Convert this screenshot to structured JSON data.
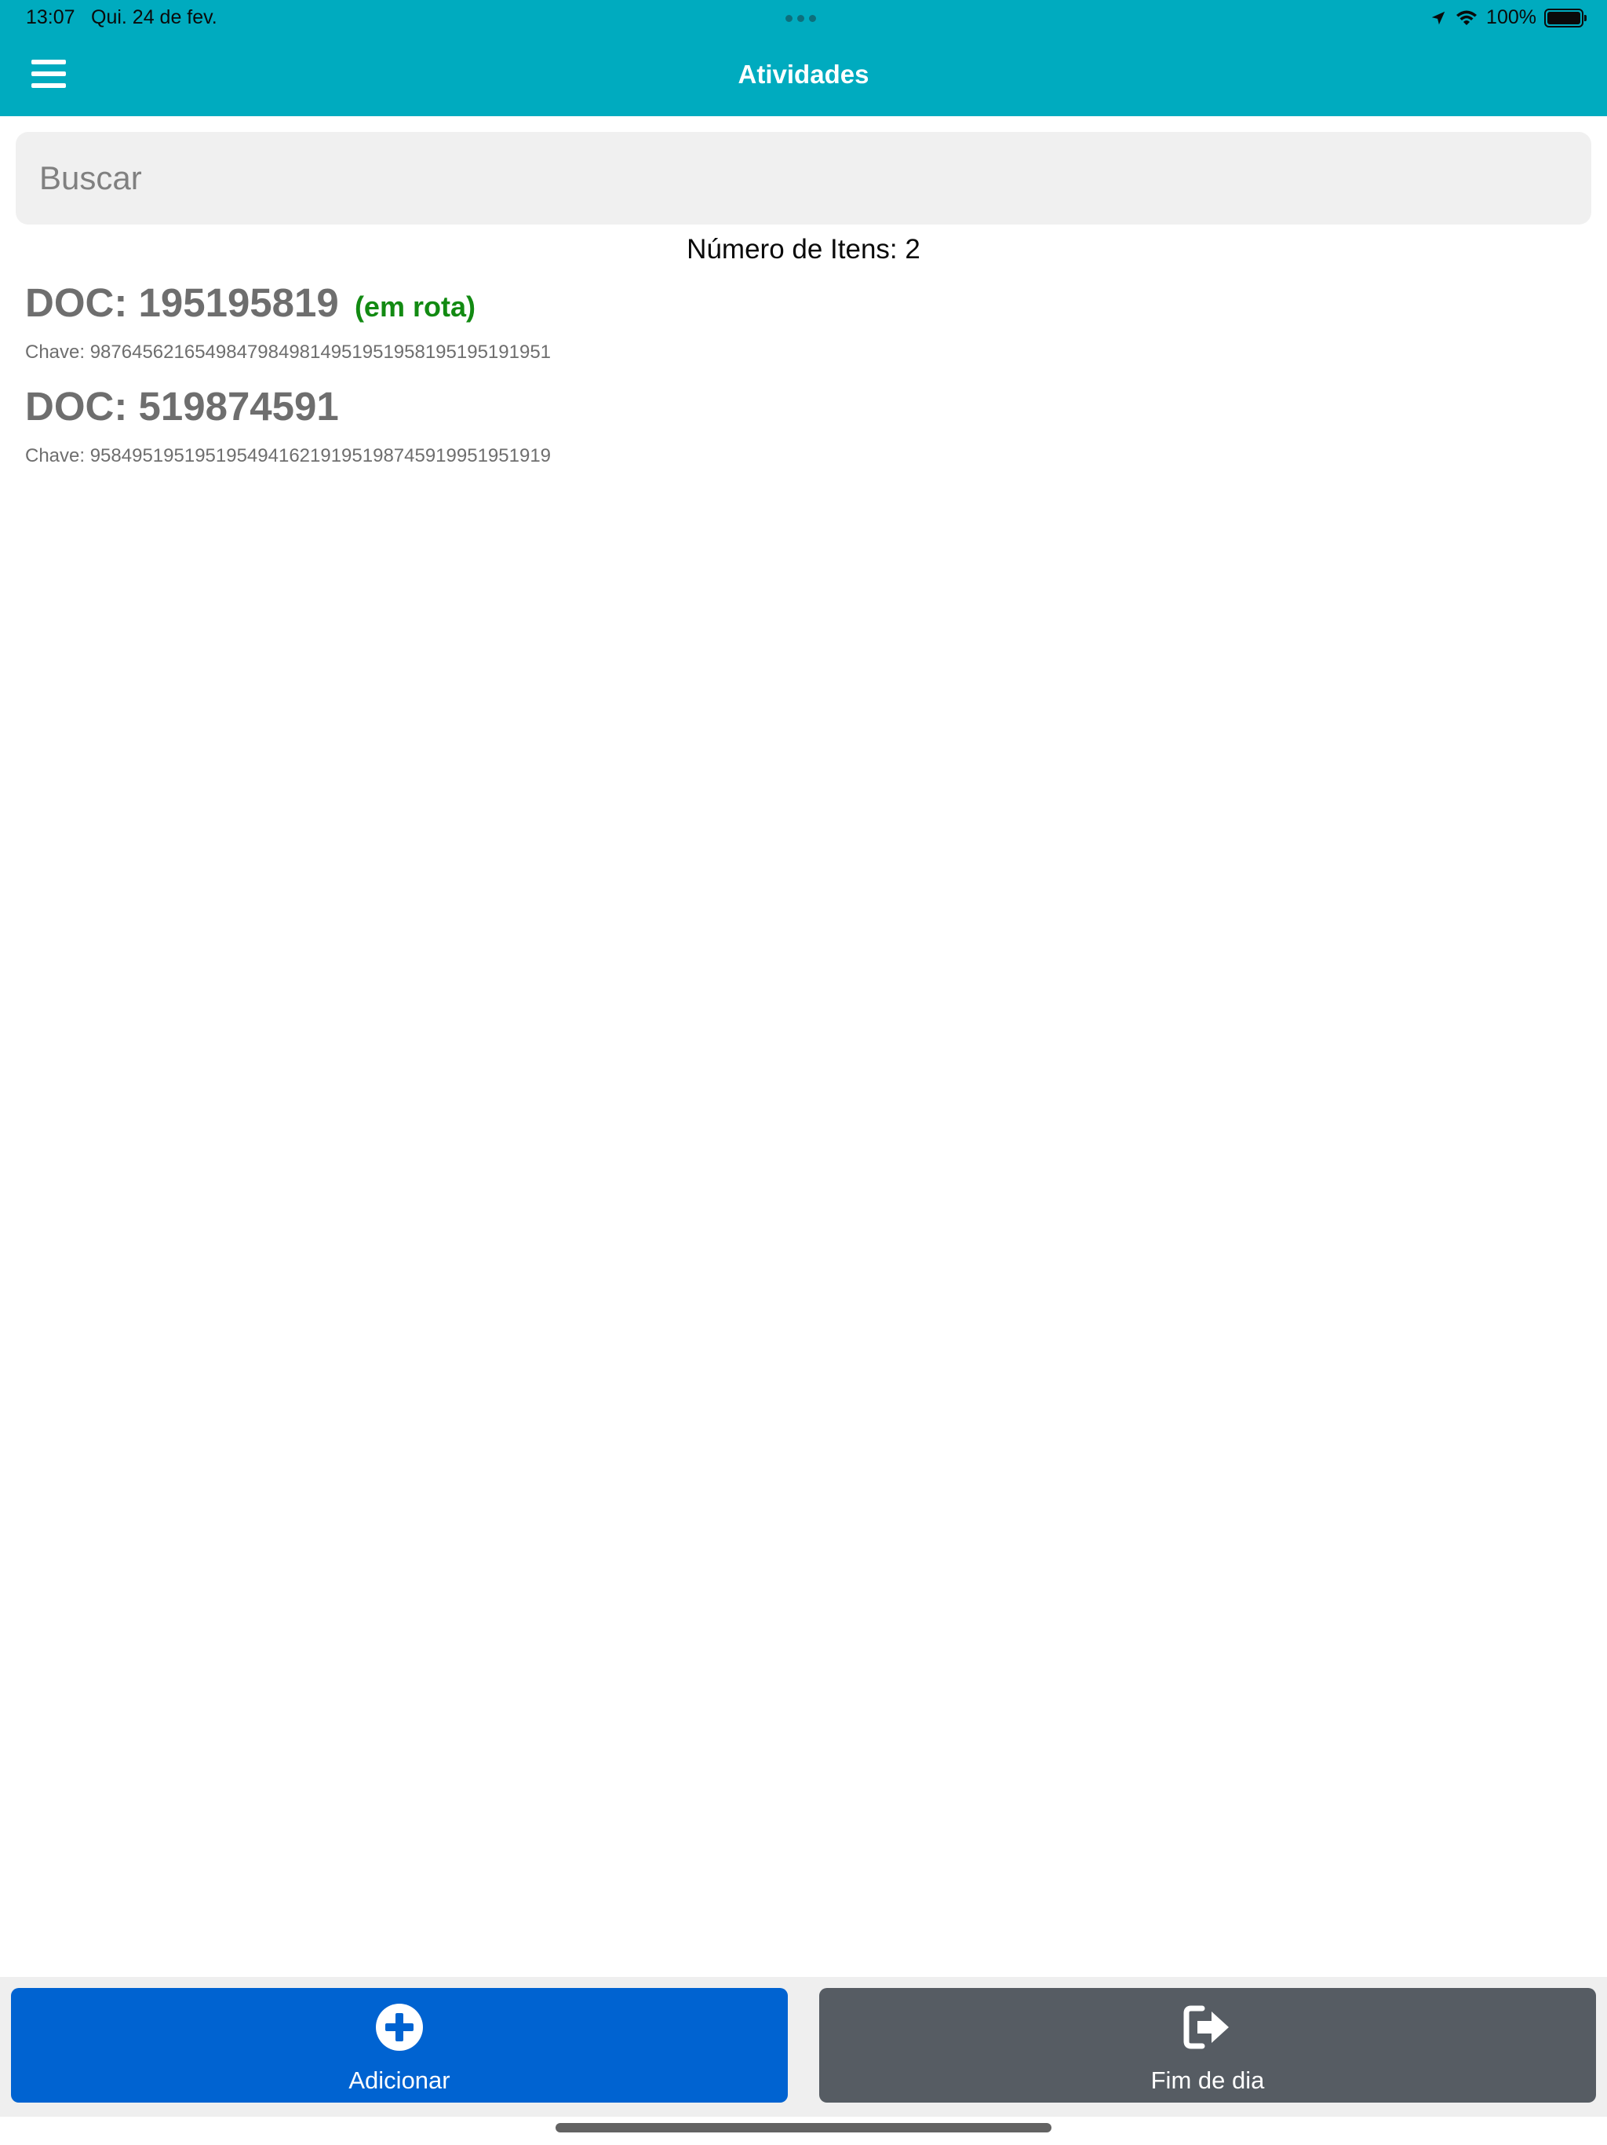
{
  "status_bar": {
    "time": "13:07",
    "date": "Qui. 24 de fev.",
    "battery": "100%",
    "icons": [
      "location-arrow-icon",
      "wifi-icon",
      "battery-icon"
    ]
  },
  "nav": {
    "title": "Atividades",
    "menu_icon": "hamburger-menu-icon"
  },
  "search": {
    "placeholder": "Buscar",
    "value": ""
  },
  "list": {
    "count_label": "Número de Itens: 2",
    "items": [
      {
        "doc": "DOC: 195195819",
        "status": "(em rota)",
        "key": "Chave: 98764562165498479849814951951958195195191951"
      },
      {
        "doc": "DOC: 519874591",
        "status": "",
        "key": "Chave: 958495195195195494162191951987459199519519​19"
      }
    ]
  },
  "actions": {
    "add_label": "Adicionar",
    "add_icon": "plus-circle-icon",
    "end_day_label": "Fim de dia",
    "end_day_icon": "sign-out-icon"
  },
  "colors": {
    "header": "#00abbf",
    "add_button": "#0063d1",
    "end_day_button": "#565c63",
    "status_green": "#128a12"
  }
}
